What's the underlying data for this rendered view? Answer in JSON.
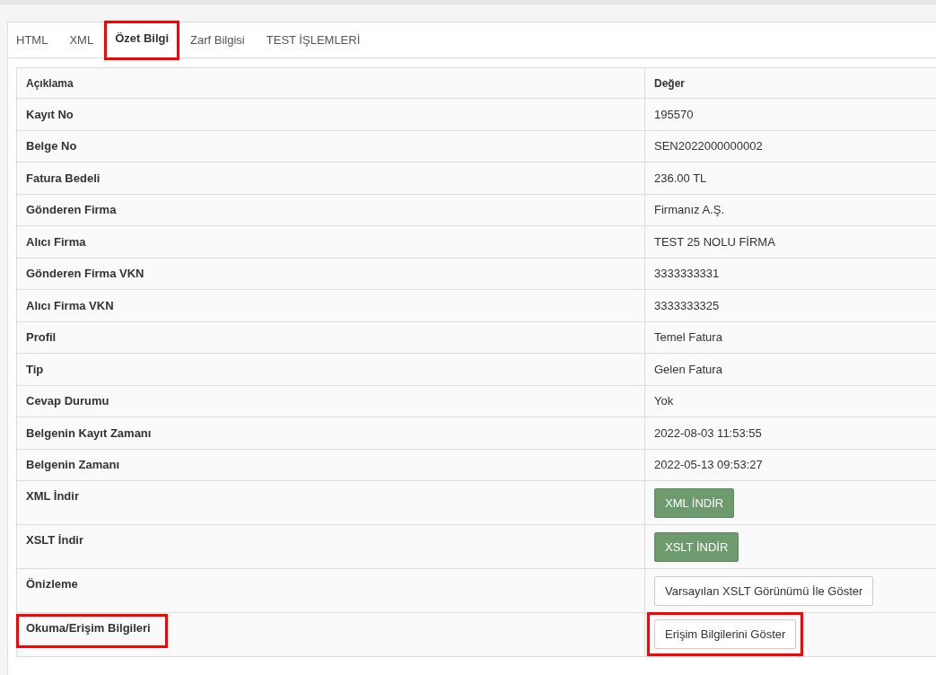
{
  "tabs": [
    {
      "label": "HTML",
      "selected": false,
      "highlighted": false
    },
    {
      "label": "XML",
      "selected": false,
      "highlighted": false
    },
    {
      "label": "Özet Bilgi",
      "selected": true,
      "highlighted": true
    },
    {
      "label": "Zarf Bilgisi",
      "selected": false,
      "highlighted": false
    },
    {
      "label": "TEST İŞLEMLERİ",
      "selected": false,
      "highlighted": false
    }
  ],
  "table": {
    "columns": [
      "Açıklama",
      "Değer"
    ],
    "rows": [
      {
        "label": "Kayıt No",
        "kind": "text",
        "value": "195570",
        "highlighted": false
      },
      {
        "label": "Belge No",
        "kind": "text",
        "value": "SEN2022000000002",
        "highlighted": false
      },
      {
        "label": "Fatura Bedeli",
        "kind": "text",
        "value": "236.00 TL",
        "highlighted": false
      },
      {
        "label": "Gönderen Firma",
        "kind": "text",
        "value": "Firmanız A.Ş.",
        "highlighted": false
      },
      {
        "label": "Alıcı Firma",
        "kind": "text",
        "value": "TEST 25 NOLU FİRMA",
        "highlighted": false
      },
      {
        "label": "Gönderen Firma VKN",
        "kind": "text",
        "value": "3333333331",
        "highlighted": false
      },
      {
        "label": "Alıcı Firma VKN",
        "kind": "text",
        "value": "3333333325",
        "highlighted": false
      },
      {
        "label": "Profil",
        "kind": "text",
        "value": "Temel Fatura",
        "highlighted": false
      },
      {
        "label": "Tip",
        "kind": "text",
        "value": "Gelen Fatura",
        "highlighted": false
      },
      {
        "label": "Cevap Durumu",
        "kind": "text",
        "value": "Yok",
        "highlighted": false
      },
      {
        "label": "Belgenin Kayıt Zamanı",
        "kind": "text",
        "value": "2022-08-03 11:53:55",
        "highlighted": false
      },
      {
        "label": "Belgenin Zamanı",
        "kind": "text",
        "value": "2022-05-13 09:53:27",
        "highlighted": false
      },
      {
        "label": "XML İndir",
        "kind": "green-button",
        "value": "XML İNDİR",
        "highlighted": false
      },
      {
        "label": "XSLT İndir",
        "kind": "green-button",
        "value": "XSLT İNDİR",
        "highlighted": false
      },
      {
        "label": "Önizleme",
        "kind": "plain-button",
        "value": "Varsayılan XSLT Görünümü İle Göster",
        "highlighted": false
      },
      {
        "label": "Okuma/Erişim Bilgileri",
        "kind": "plain-button",
        "value": "Erişim Bilgilerini Göster",
        "highlighted": true
      }
    ]
  }
}
